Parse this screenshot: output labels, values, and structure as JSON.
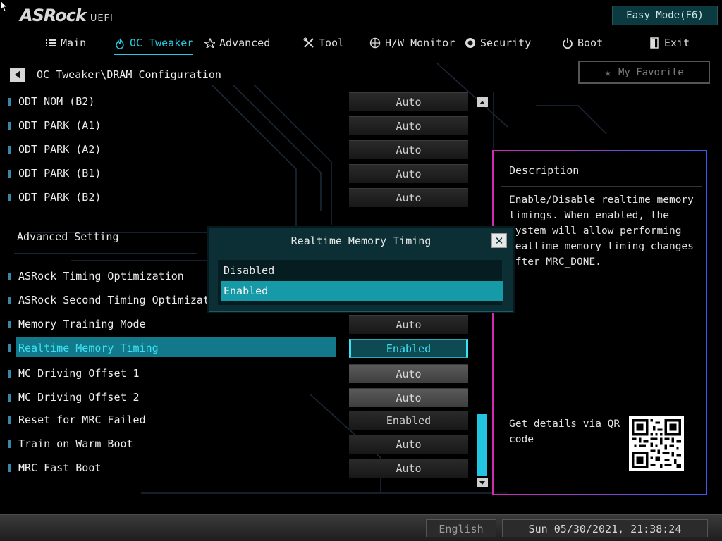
{
  "header": {
    "logo_main": "ASRock",
    "logo_sub": "UEFI",
    "easy_mode_label": "Easy Mode(F6)"
  },
  "tabs": [
    {
      "label": "Main",
      "icon": "list-icon"
    },
    {
      "label": "OC Tweaker",
      "icon": "flame-icon",
      "active": true
    },
    {
      "label": "Advanced",
      "icon": "star-outline-icon"
    },
    {
      "label": "Tool",
      "icon": "tools-icon"
    },
    {
      "label": "H/W Monitor",
      "icon": "crosshair-icon"
    },
    {
      "label": "Security",
      "icon": "shield-icon"
    },
    {
      "label": "Boot",
      "icon": "power-icon"
    },
    {
      "label": "Exit",
      "icon": "exit-door-icon"
    }
  ],
  "breadcrumb": "OC Tweaker\\DRAM Configuration",
  "favorite_label": "My Favorite",
  "settings_top": [
    {
      "label": "ODT NOM  (B2)",
      "value": "Auto"
    },
    {
      "label": "ODT PARK (A1)",
      "value": "Auto"
    },
    {
      "label": "ODT PARK (A2)",
      "value": "Auto"
    },
    {
      "label": "ODT PARK (B1)",
      "value": "Auto"
    },
    {
      "label": "ODT PARK (B2)",
      "value": "Auto"
    }
  ],
  "section_title": "Advanced Setting",
  "settings_bottom": [
    {
      "label": "ASRock Timing Optimization",
      "value": ""
    },
    {
      "label": "ASRock Second Timing Optimization",
      "value": ""
    },
    {
      "label": "Memory Training Mode",
      "value": "Auto"
    },
    {
      "label": "Realtime Memory Timing",
      "value": "Enabled"
    },
    {
      "label": "MC Driving Offset 1",
      "value": "Auto"
    },
    {
      "label": "MC Driving Offset 2",
      "value": "Auto"
    },
    {
      "label": "Reset for MRC Failed",
      "value": "Enabled"
    },
    {
      "label": "Train on Warm Boot",
      "value": "Auto"
    },
    {
      "label": "MRC Fast Boot",
      "value": "Auto"
    }
  ],
  "description": {
    "title": "Description",
    "body": "Enable/Disable realtime memory timings. When enabled, the system will allow performing realtime memory timing changes after MRC_DONE.",
    "qr_text": "Get details via QR code"
  },
  "modal": {
    "title": "Realtime Memory Timing",
    "options": [
      "Disabled",
      "Enabled"
    ],
    "selected": "Enabled"
  },
  "status": {
    "language": "English",
    "datetime": "Sun 05/30/2021, 21:38:24"
  },
  "colors": {
    "accent": "#27c9e0",
    "selection": "#12798a",
    "panel_border_left": "#d22ab0",
    "panel_border_right": "#3a5cf0"
  }
}
